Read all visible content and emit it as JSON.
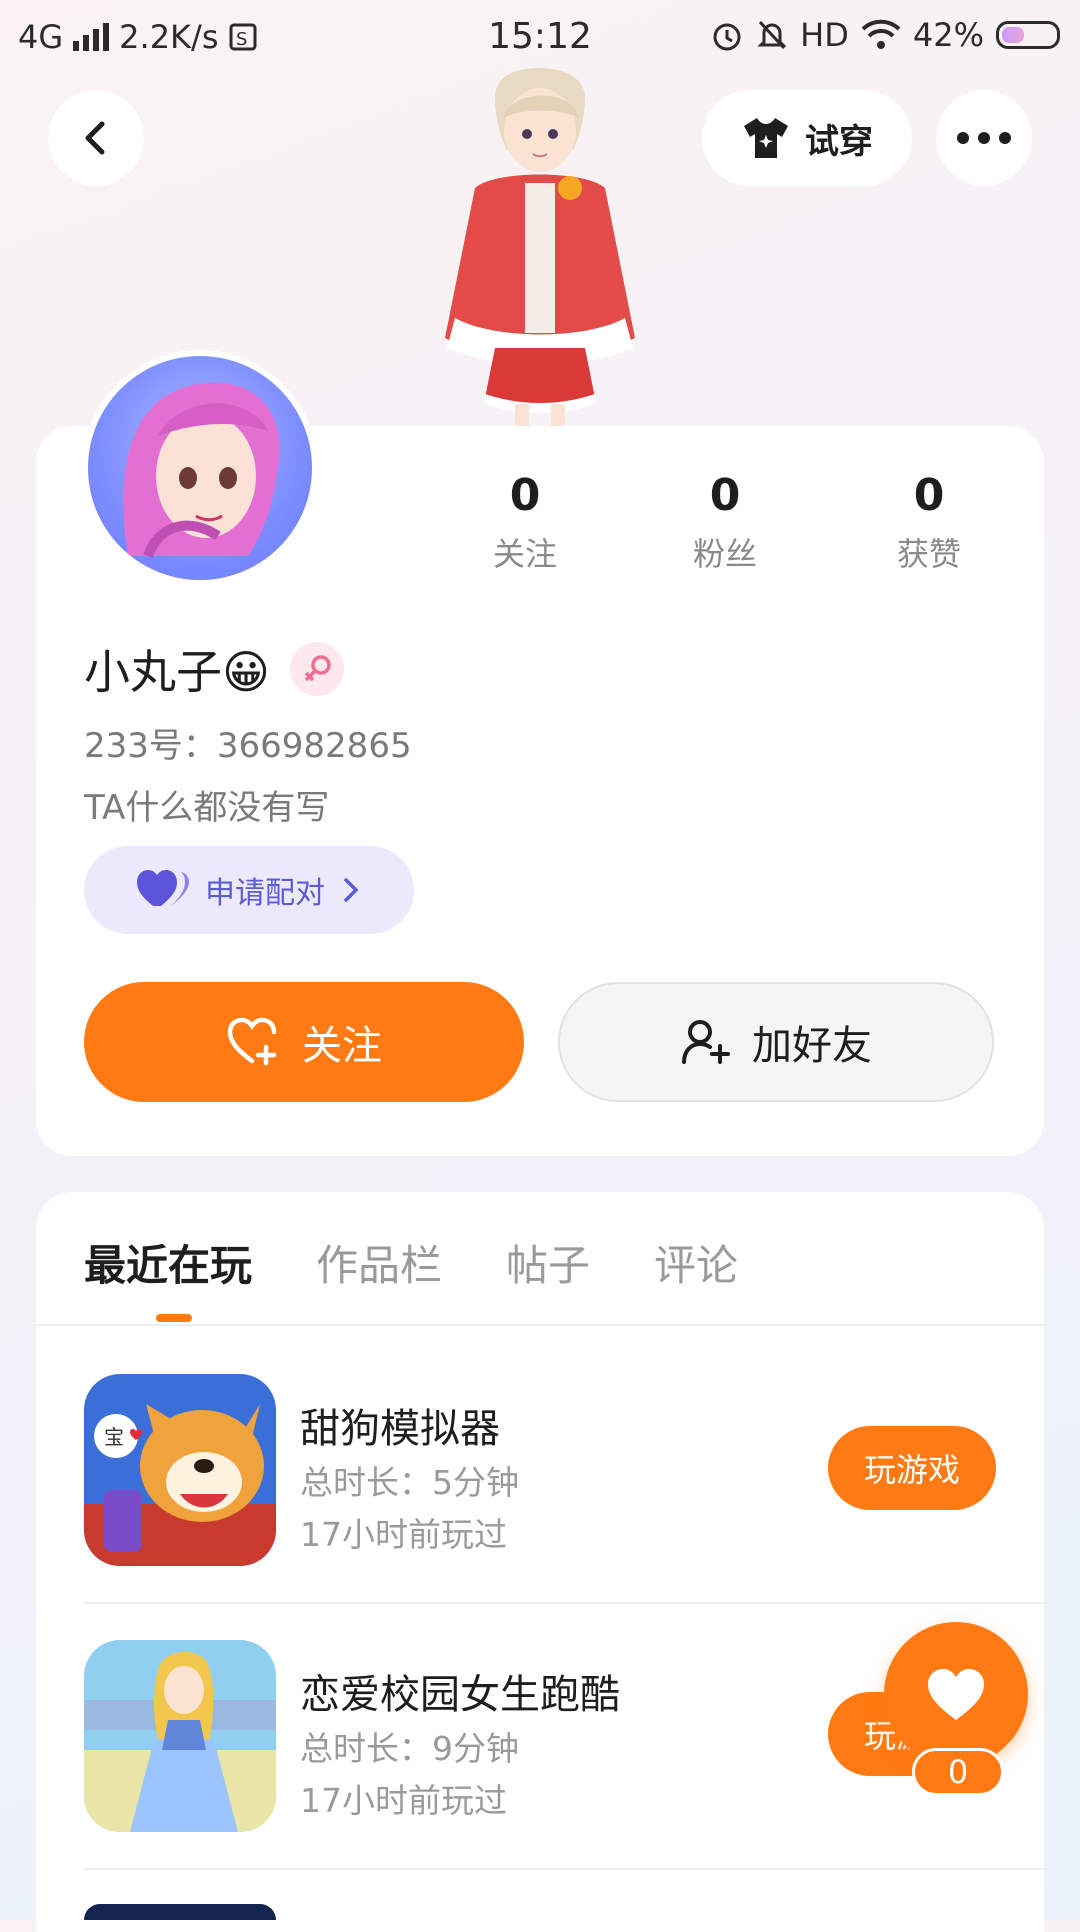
{
  "status_bar": {
    "network": "4G",
    "speed": "2.2K/s",
    "time": "15:12",
    "hd": "HD",
    "battery": "42%",
    "battery_level": 0.42
  },
  "header": {
    "tryon_label": "试穿"
  },
  "profile": {
    "stats": [
      {
        "value": "0",
        "label": "关注"
      },
      {
        "value": "0",
        "label": "粉丝"
      },
      {
        "value": "0",
        "label": "获赞"
      }
    ],
    "nickname": "小丸子😀",
    "uid": "233号：366982865",
    "bio": "TA什么都没有写",
    "pair_label": "申请配对",
    "follow_label": "关注",
    "add_friend_label": "加好友"
  },
  "tabs": [
    {
      "label": "最近在玩",
      "active": true
    },
    {
      "label": "作品栏",
      "active": false
    },
    {
      "label": "帖子",
      "active": false
    },
    {
      "label": "评论",
      "active": false
    }
  ],
  "games": [
    {
      "title": "甜狗模拟器",
      "duration": "总时长：5分钟",
      "last_played": "17小时前玩过",
      "play_label": "玩游戏",
      "icon": "shiba-dog-game-icon"
    },
    {
      "title": "恋爱校园女生跑酷",
      "duration": "总时长：9分钟",
      "last_played": "17小时前玩过",
      "play_label": "玩游戏",
      "icon": "anime-girl-parkour-game-icon"
    }
  ],
  "fab": {
    "like_count": "0"
  },
  "colors": {
    "accent": "#ff7a12",
    "pair_bg": "#ebe9fb",
    "pair_text": "#5b5bd6"
  }
}
